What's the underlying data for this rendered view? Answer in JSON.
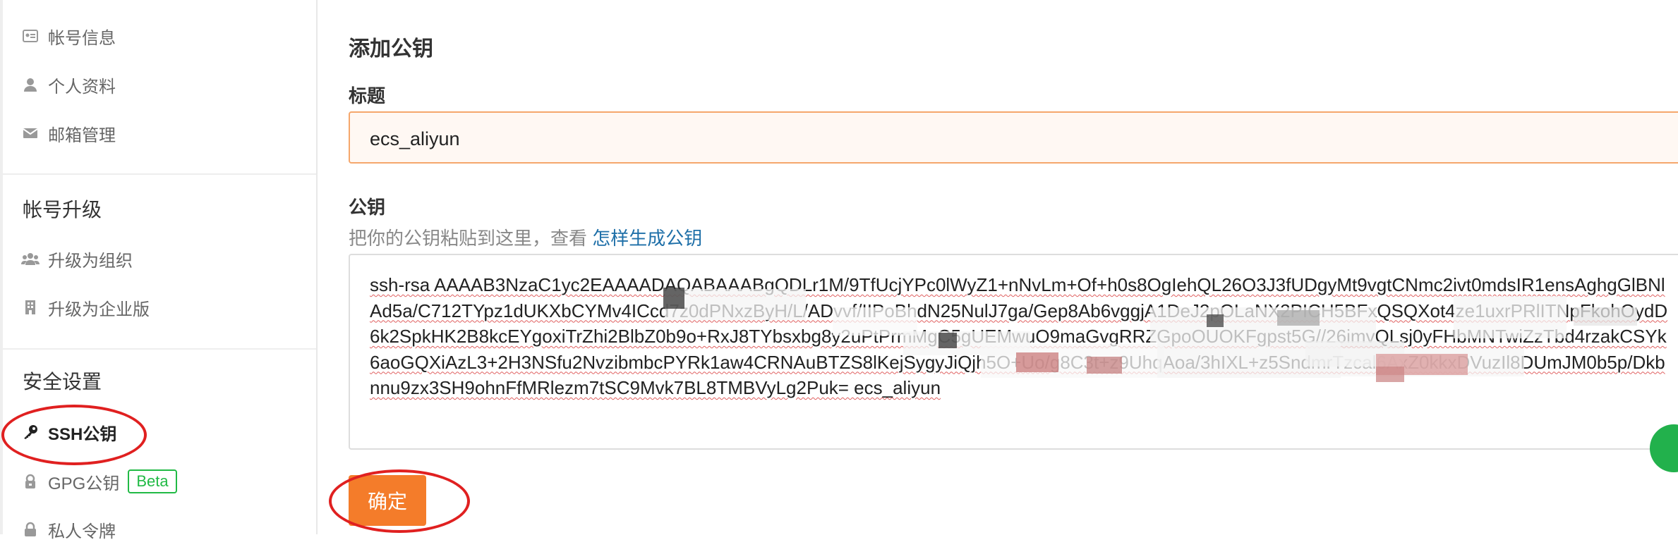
{
  "sidebar": {
    "items_top": [
      {
        "label": "帐号信息",
        "icon": "id-card-icon"
      },
      {
        "label": "个人资料",
        "icon": "user-icon"
      },
      {
        "label": "邮箱管理",
        "icon": "envelope-icon"
      }
    ],
    "section_upgrade": "帐号升级",
    "items_upgrade": [
      {
        "label": "升级为组织",
        "icon": "users-icon"
      },
      {
        "label": "升级为企业版",
        "icon": "building-icon"
      }
    ],
    "section_security": "安全设置",
    "items_security": [
      {
        "label": "SSH公钥",
        "icon": "key-icon",
        "active": true
      },
      {
        "label": "GPG公钥",
        "icon": "gpg-key-icon",
        "badge": "Beta"
      },
      {
        "label": "私人令牌",
        "icon": "lock-icon"
      }
    ]
  },
  "form": {
    "heading": "添加公钥",
    "title_label": "标题",
    "title_value": "ecs_aliyun",
    "key_label": "公钥",
    "hint_text": "把你的公钥粘贴到这里，查看 ",
    "hint_link": "怎样生成公钥",
    "key_value": "ssh-rsa AAAAB3NzaC1yc2EAAAADAQABAAABgQDLr1M/9TfUcjYPc0lWyZ1+nNvLm+Of+h0s8OgIehQL26O3J3fUDgyMt9vgtCNmc2ivt0mdsIR1ensAghgGlBNlAd5a/C712TYpz1dUKXbCYMv4ICcd7z0dPNxzByH/L/ADvvf/IIPoBhdN25NulJ7ga/Gep8Ab6vggjA1DeJ2pOLaNX2PICH5BFxQSQXot4ze1uxrPRlITNpFkohOydD6k2SpkHK2B8kcEYgoxiTrZhi2BlbZ0b9o+RxJ8TYbsxbg8y2uPtPrmMgC5gUEMwuO9maGvgRRZGpoOUOKFgpst5G//26imvQLsj0yFHbMNTwiZzTbd4rzakCSYk6aoGQXiAzL3+2H3NSfu2NvzibmbcPYRk1aw4CRNAuBTZS8lKejSygyJiQjh5O+Uo/g8C3t+z9UhqAoa/3hIXL+z5SndmrTzcal6AxZ0kkxDVuzIl8DUmJM0b5p/Dkbnnu9zx3SH9ohnFfMRlezm7tSC9Mvk7BL8TMBVyLg2Puk= ecs_aliyun",
    "submit_label": "确定"
  },
  "colors": {
    "accent": "#f47c2a",
    "link": "#1e6fa8",
    "beta": "#21ba45",
    "annotation": "#e02020"
  }
}
